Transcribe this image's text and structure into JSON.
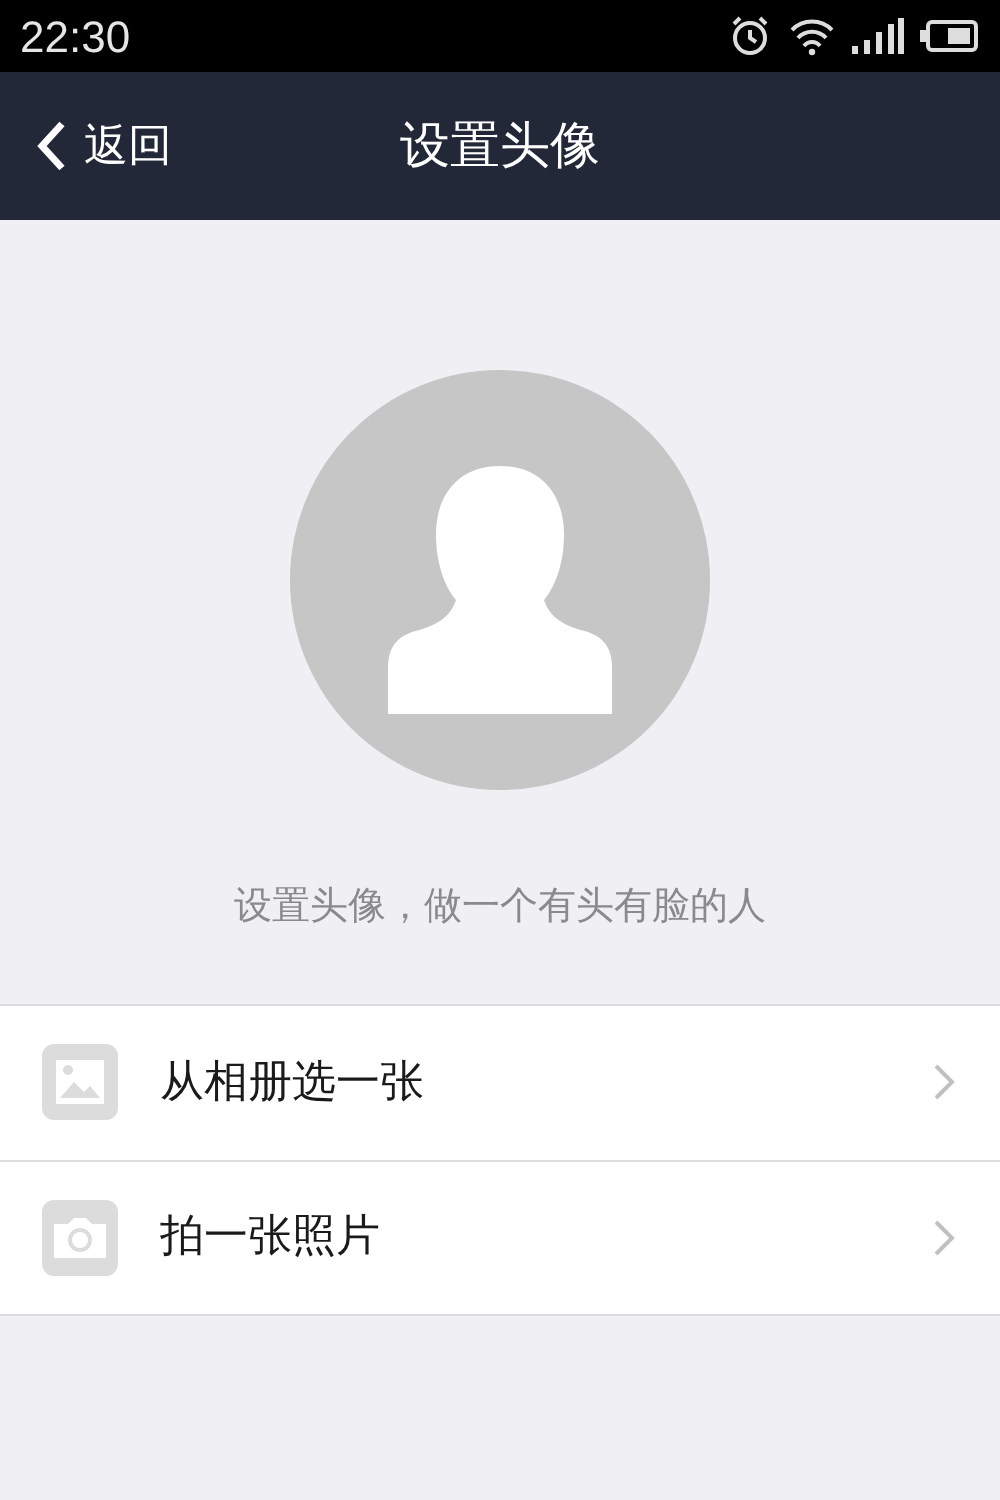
{
  "status_bar": {
    "time": "22:30"
  },
  "nav_bar": {
    "back": "返回",
    "title": "设置头像"
  },
  "caption": "设置头像，做一个有头有脸的人",
  "options": [
    {
      "kind": "album",
      "label": "从相册选一张"
    },
    {
      "kind": "camera",
      "label": "拍一张照片"
    }
  ]
}
